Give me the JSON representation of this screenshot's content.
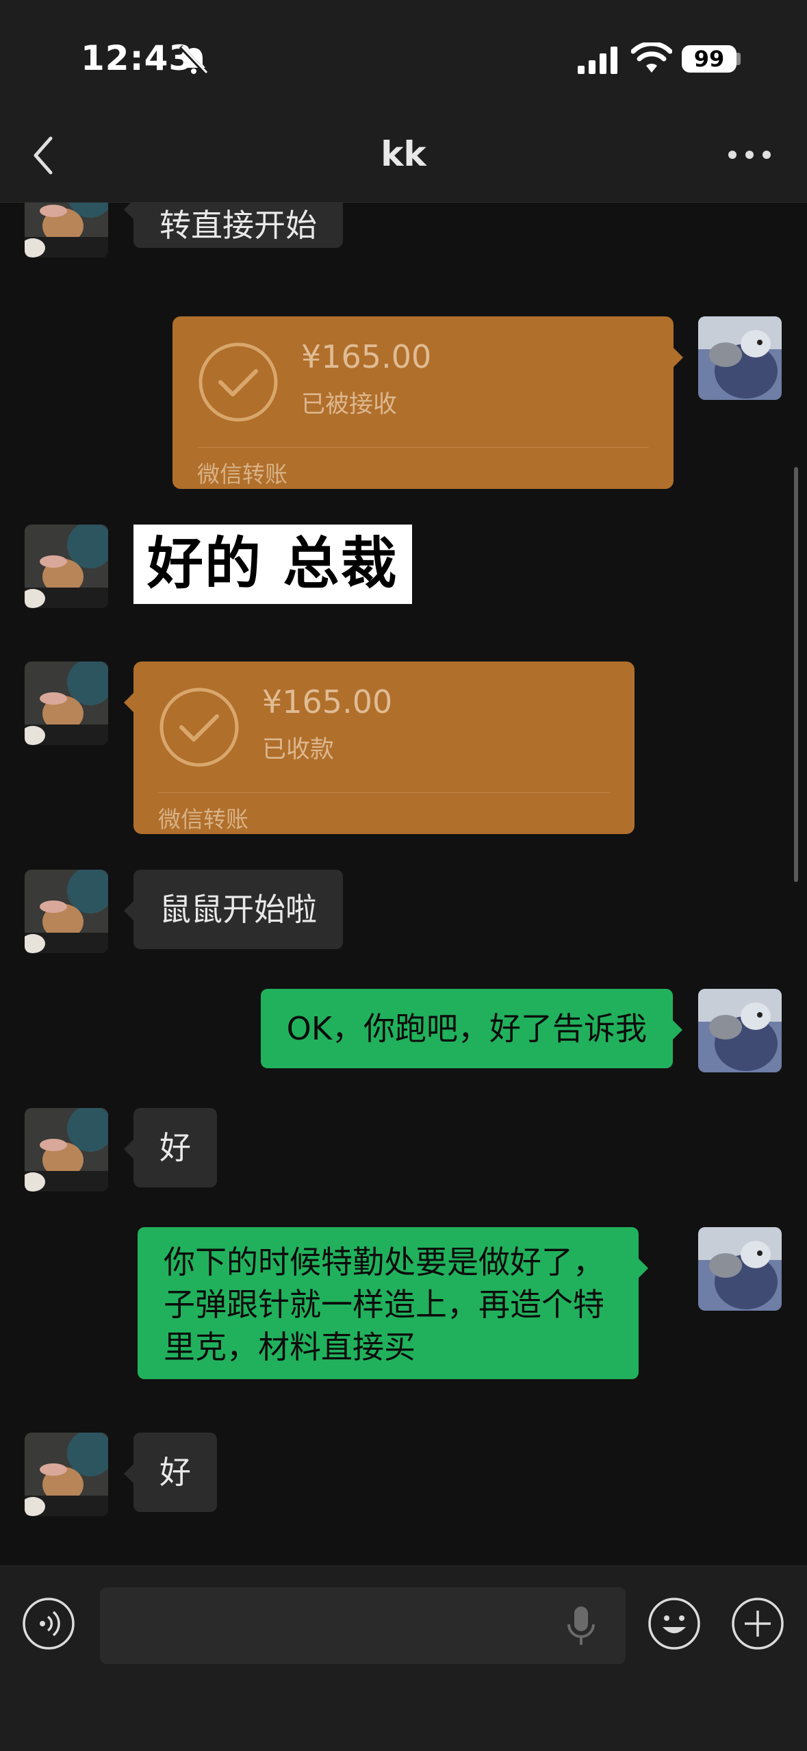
{
  "status_bar": {
    "time": "12:43",
    "battery": "99"
  },
  "nav": {
    "title": "kk"
  },
  "messages": {
    "m1": {
      "text": "转直接开始"
    },
    "m2": {
      "amount": "¥165.00",
      "status": "已被接收",
      "footer": "微信转账"
    },
    "m3": {
      "text": "好的 总裁"
    },
    "m4": {
      "amount": "¥165.00",
      "status": "已收款",
      "footer": "微信转账"
    },
    "m5": {
      "text": "鼠鼠开始啦"
    },
    "m6": {
      "text": "OK，你跑吧，好了告诉我"
    },
    "m7": {
      "text": "好"
    },
    "m8": {
      "line1": "你下的时候特勤处要是做好了，",
      "line2": "子弹跟针就一样造上，再造个特",
      "line3": "里克，材料直接买"
    },
    "m9": {
      "text": "好"
    }
  },
  "colors": {
    "background": "#111111",
    "bar": "#1e1e1e",
    "incoming_bubble": "#2c2c2c",
    "outgoing_bubble": "#21b15c",
    "transfer": "#b06f2b"
  },
  "icons": {
    "back": "chevron-left-icon",
    "more": "more-dots-icon",
    "voice": "voice-mode-icon",
    "mic": "microphone-icon",
    "emoji": "emoji-icon",
    "plus": "plus-icon"
  }
}
